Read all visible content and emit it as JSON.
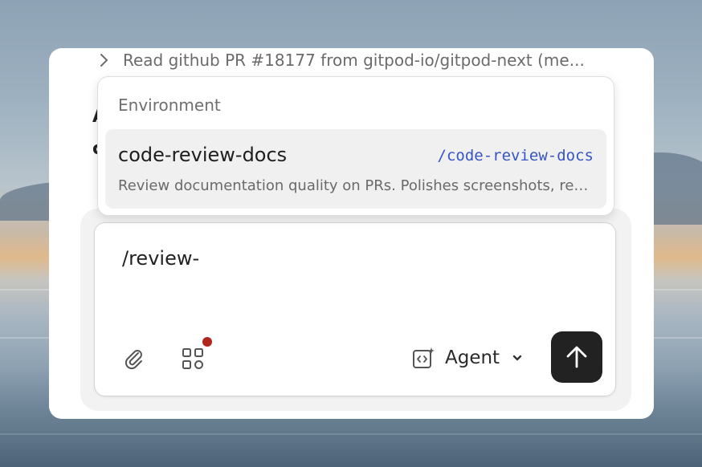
{
  "thread": {
    "summary": "Read github PR #18177 from gitpod-io/gitpod-next (me..."
  },
  "background_peek": {
    "line1": "A",
    "line2": "c"
  },
  "dropdown": {
    "heading": "Environment",
    "items": [
      {
        "name": "code-review-docs",
        "command": "/code-review-docs",
        "description": "Review documentation quality on PRs. Polishes screenshots, revi…"
      }
    ]
  },
  "composer": {
    "value": "/review-",
    "mode_label": "Agent",
    "attach_icon": "paperclip-icon",
    "apps_icon": "apps-grid-icon",
    "mode_icon": "code-sparkle-icon",
    "send_icon": "arrow-up-icon"
  },
  "colors": {
    "accent_link": "#3554c8",
    "send_button": "#222222",
    "notification_dot": "#b3261e"
  }
}
